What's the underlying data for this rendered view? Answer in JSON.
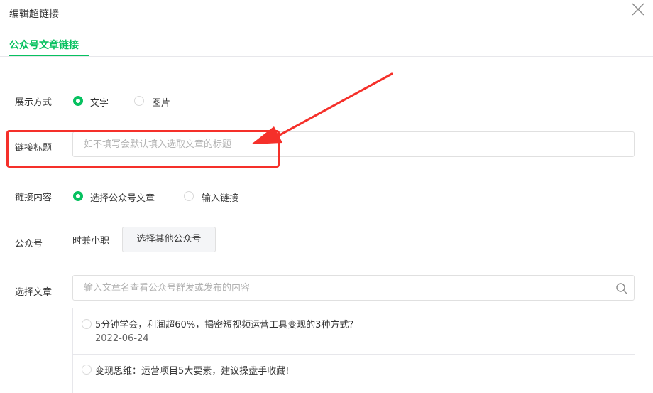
{
  "dialog": {
    "title": "编辑超链接"
  },
  "tabs": [
    {
      "label": "公众号文章链接",
      "active": true
    }
  ],
  "form": {
    "display_mode": {
      "label": "展示方式",
      "options": [
        {
          "label": "文字",
          "selected": true
        },
        {
          "label": "图片",
          "selected": false
        }
      ]
    },
    "link_title": {
      "label": "链接标题",
      "placeholder": "如不填写会默认填入选取文章的标题",
      "value": ""
    },
    "link_content": {
      "label": "链接内容",
      "options": [
        {
          "label": "选择公众号文章",
          "selected": true
        },
        {
          "label": "输入链接",
          "selected": false
        }
      ]
    },
    "account": {
      "label": "公众号",
      "current": "时兼小职",
      "button_label": "选择其他公众号"
    },
    "article": {
      "label": "选择文章",
      "search_placeholder": "输入文章名查看公众号群发或发布的内容",
      "items": [
        {
          "title": "5分钟学会，利润超60%，揭密短视频运营工具变现的3种方式?",
          "date": "2022-06-24",
          "selected": false
        },
        {
          "title": "变现思维：运营项目5大要素，建议操盘手收藏!",
          "date": "",
          "selected": false
        }
      ]
    }
  },
  "colors": {
    "accent": "#07c160",
    "annotation": "#f5302a",
    "border": "#e0e0e0"
  },
  "icons": {
    "close": "close-icon",
    "search": "search-icon",
    "annotation_arrow": "arrow-annotation"
  }
}
